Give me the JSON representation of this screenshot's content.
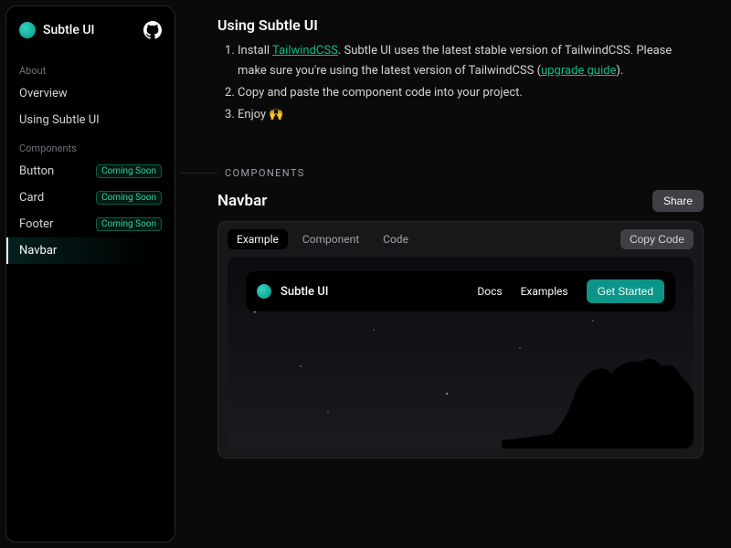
{
  "brand": "Subtle UI",
  "sidebar": {
    "sections": [
      {
        "label": "About",
        "items": [
          {
            "label": "Overview",
            "badge": null,
            "active": false
          },
          {
            "label": "Using Subtle UI",
            "badge": null,
            "active": false
          }
        ]
      },
      {
        "label": "Components",
        "items": [
          {
            "label": "Button",
            "badge": "Coming Soon",
            "active": false
          },
          {
            "label": "Card",
            "badge": "Coming Soon",
            "active": false
          },
          {
            "label": "Footer",
            "badge": "Coming Soon",
            "active": false
          },
          {
            "label": "Navbar",
            "badge": null,
            "active": true
          }
        ]
      }
    ]
  },
  "doc": {
    "heading": "Using Subtle UI",
    "step1_prefix": "Install ",
    "step1_link": "TailwindCSS",
    "step1_mid": ". Subtle UI uses the latest stable version of TailwindCSS. Please make sure you're using the latest version of TailwindCSS (",
    "step1_link2": "upgrade guide",
    "step1_suffix": ").",
    "step2": "Copy and paste the component code into your project.",
    "step3": "Enjoy 🙌"
  },
  "section_divider": "COMPONENTS",
  "component": {
    "title": "Navbar",
    "share": "Share",
    "tabs": [
      "Example",
      "Component",
      "Code"
    ],
    "active_tab": 0,
    "copy": "Copy Code"
  },
  "demo": {
    "brand": "Subtle UI",
    "links": [
      "Docs",
      "Examples"
    ],
    "cta": "Get Started"
  }
}
